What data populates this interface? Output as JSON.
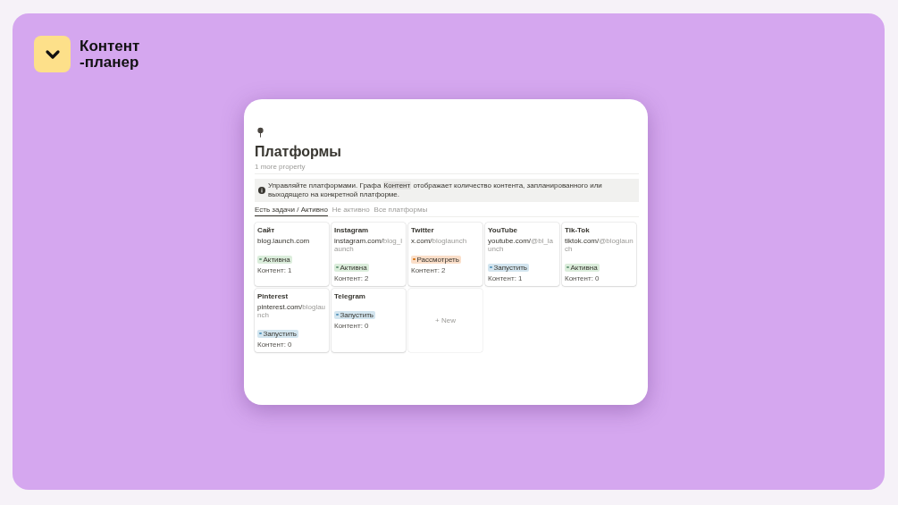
{
  "brand": {
    "name": "Контент\n-планер"
  },
  "page": {
    "title": "Платформы",
    "more": "1 more property",
    "callout": {
      "before": "Управляйте платформами. Графа",
      "tag": "Контент",
      "after": "отображает количество контента, запланированного или выходящего на конкретной платформе."
    },
    "tabs": [
      {
        "label": "Есть задачи / Активно",
        "selected": true
      },
      {
        "label": "Не активно",
        "selected": false
      },
      {
        "label": "Все платформы",
        "selected": false
      }
    ],
    "cards": [
      {
        "title": "Сайт",
        "domain": "blog.launch.com",
        "status": "Активна",
        "color": "#dbeddb",
        "count": "Контент: 1"
      },
      {
        "title": "Instagram",
        "domain": "instagram.com/",
        "path": "blog_launch",
        "status": "Активна",
        "color": "#dbeddb",
        "count": "Контент: 2"
      },
      {
        "title": "Twitter",
        "domain": "x.com/",
        "path": "bloglaunch",
        "status": "Рассмотреть",
        "color": "#fadec9",
        "count": "Контент: 2"
      },
      {
        "title": "YouTube",
        "domain": "youtube.com/",
        "path": "@bl_launch",
        "status": "Запустить",
        "color": "#d3e5ef",
        "count": "Контент: 1"
      },
      {
        "title": "Tik-Tok",
        "domain": "tiktok.com/",
        "path": "@bloglaunch",
        "status": "Активна",
        "color": "#dbeddb",
        "count": "Контент: 0"
      },
      {
        "title": "Pinterest",
        "domain": "pinterest.com/",
        "path": "bloglaunch",
        "status": "Запустить",
        "color": "#d3e5ef",
        "count": "Контент: 0"
      },
      {
        "title": "Telegram",
        "status": "Запустить",
        "color": "#d3e5ef",
        "count": "Контент: 0"
      }
    ],
    "new_label": "+ New"
  }
}
